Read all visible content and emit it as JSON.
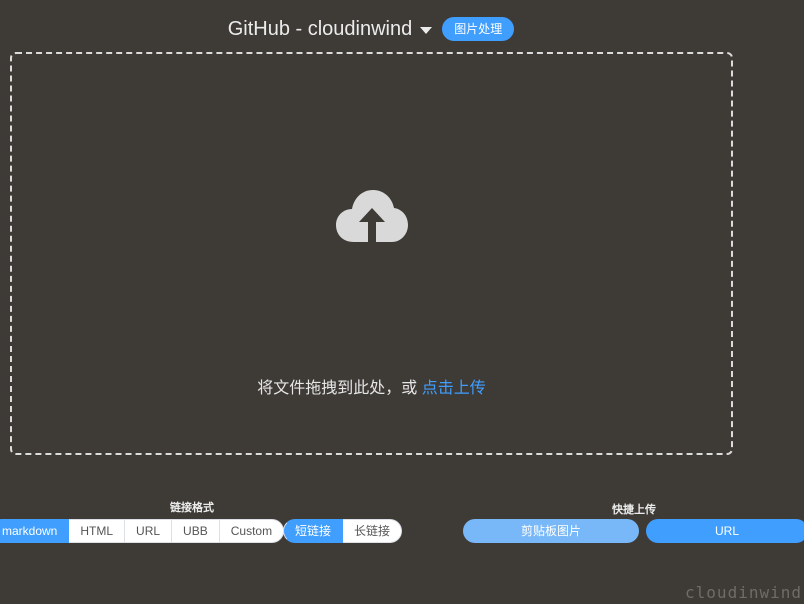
{
  "header": {
    "title": "GitHub - cloudinwind",
    "picture_button": "图片处理"
  },
  "dropzone": {
    "text": "将文件拖拽到此处，或 ",
    "link": "点击上传"
  },
  "link_format": {
    "label": "链接格式",
    "options": [
      "markdown",
      "HTML",
      "URL",
      "UBB",
      "Custom"
    ],
    "selected": "markdown"
  },
  "link_length": {
    "options": [
      "短链接",
      "长链接"
    ],
    "selected": "短链接"
  },
  "quick_upload": {
    "label": "快捷上传",
    "clipboard_button": "剪贴板图片",
    "url_button": "URL"
  },
  "watermark": "cloudinwind",
  "colors": {
    "background": "#3e3b37",
    "accent": "#409eff",
    "accent_light": "#79b8f8"
  }
}
